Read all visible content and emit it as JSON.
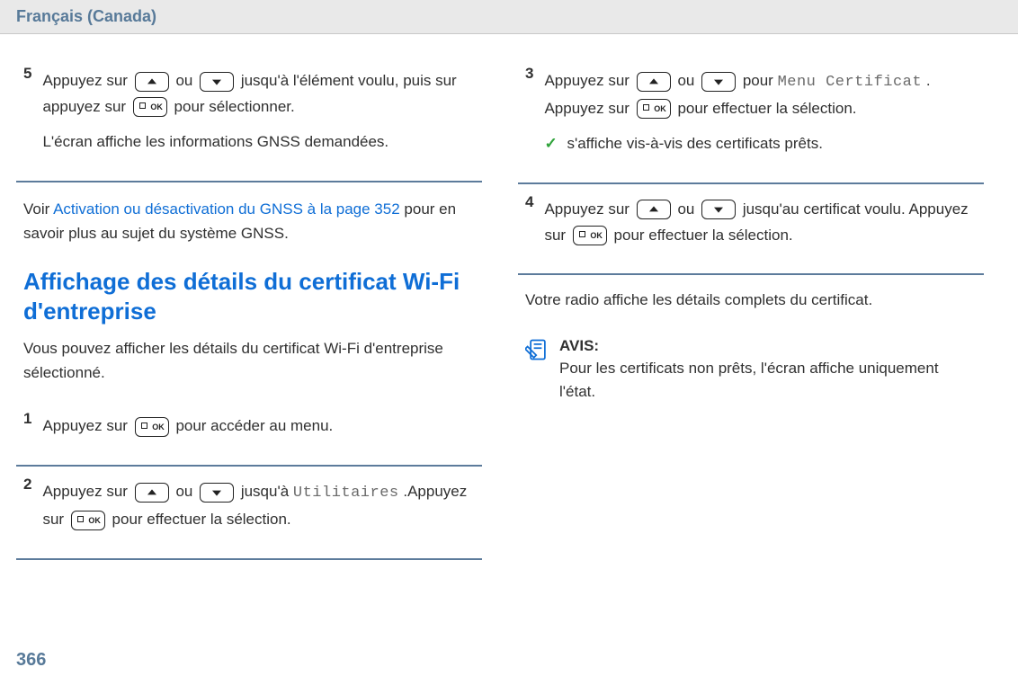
{
  "header": {
    "language": "Français (Canada)"
  },
  "left": {
    "step5": {
      "num": "5",
      "frag1": "Appuyez sur ",
      "frag2": " ou ",
      "frag3": " jusqu'à l'élément voulu, puis sur appuyez sur ",
      "frag4": " pour sélectionner.",
      "line2": "L'écran affiche les informations GNSS demandées."
    },
    "cross_ref": {
      "pre": "Voir ",
      "link": "Activation ou désactivation du GNSS à la page 352",
      "post": " pour en savoir plus au sujet du système GNSS."
    },
    "section_title": "Affichage des détails du certificat Wi-Fi d'entreprise",
    "section_intro": "Vous pouvez afficher les détails du certificat Wi-Fi d'entreprise sélectionné.",
    "step1": {
      "num": "1",
      "frag1": "Appuyez sur ",
      "frag2": " pour accéder au menu."
    },
    "step2": {
      "num": "2",
      "frag1": "Appuyez sur ",
      "frag2": " ou ",
      "frag3": " jusqu'à ",
      "menu": "Utilitaires",
      "frag4": ".Appuyez sur ",
      "frag5": " pour effectuer la sélection."
    }
  },
  "right": {
    "step3": {
      "num": "3",
      "frag1": "Appuyez sur ",
      "frag2": " ou ",
      "frag3": " pour ",
      "menu1": "Menu Certificat",
      "frag4": ". Appuyez sur ",
      "frag5": " pour effectuer la sélection.",
      "check_text": " s'affiche vis-à-vis des certificats prêts."
    },
    "step4": {
      "num": "4",
      "frag1": "Appuyez sur ",
      "frag2": " ou ",
      "frag3": " jusqu'au certificat voulu. Appuyez sur ",
      "frag4": " pour effectuer la sélection."
    },
    "result": "Votre radio affiche les détails complets du certificat.",
    "note": {
      "label": "AVIS:",
      "body": "Pour les certificats non prêts, l'écran affiche uniquement l'état."
    }
  },
  "page_number": "366"
}
